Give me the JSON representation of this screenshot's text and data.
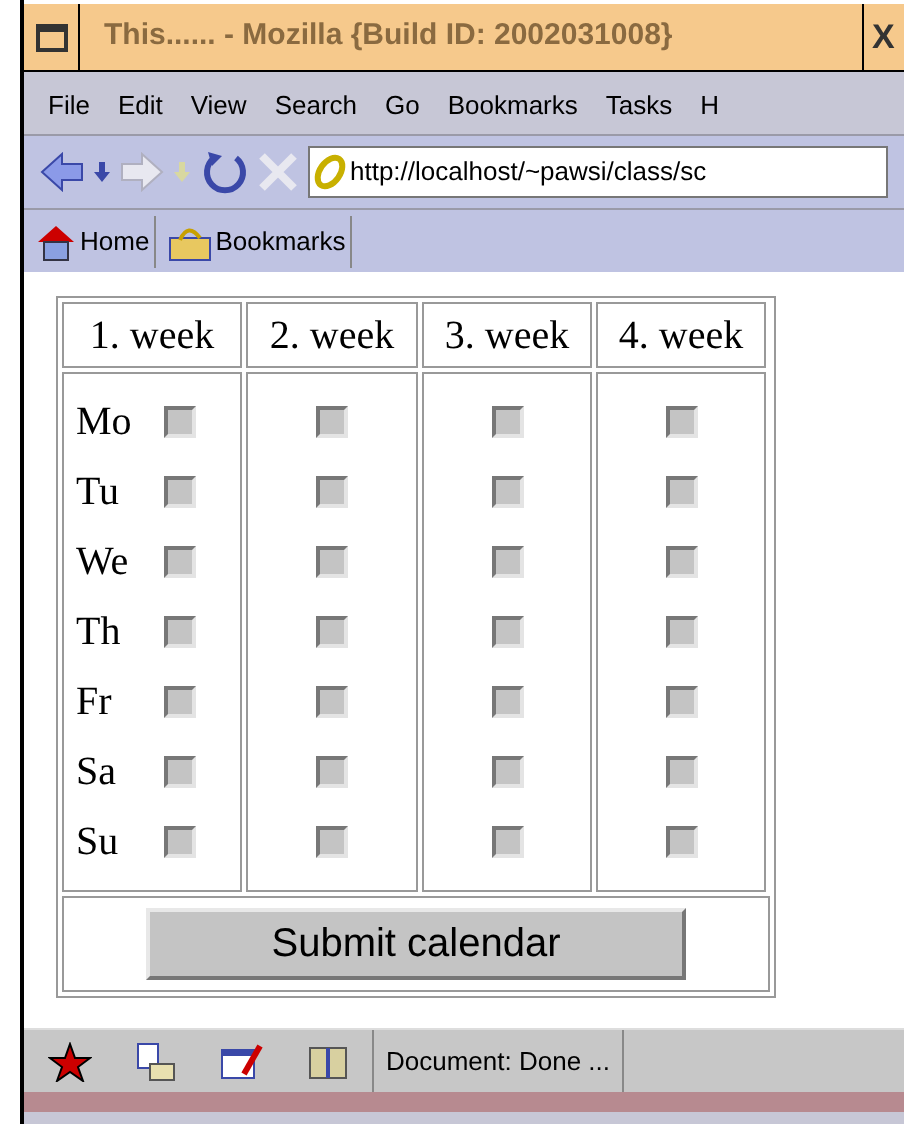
{
  "window": {
    "title": "This...... - Mozilla {Build ID: 2002031008}",
    "close": "X"
  },
  "menu": [
    "File",
    "Edit",
    "View",
    "Search",
    "Go",
    "Bookmarks",
    "Tasks",
    "H"
  ],
  "address": {
    "value": "http://localhost/~pawsi/class/sc"
  },
  "personal_toolbar": [
    "Home",
    "Bookmarks"
  ],
  "weeks": [
    "1. week",
    "2. week",
    "3. week",
    "4. week"
  ],
  "days": [
    {
      "label": "Mo",
      "checked": [
        false,
        false,
        false,
        false
      ]
    },
    {
      "label": "Tu",
      "checked": [
        false,
        false,
        false,
        false
      ]
    },
    {
      "label": "We",
      "checked": [
        false,
        false,
        false,
        false
      ]
    },
    {
      "label": "Th",
      "checked": [
        false,
        false,
        false,
        false
      ]
    },
    {
      "label": "Fr",
      "checked": [
        false,
        false,
        false,
        false
      ]
    },
    {
      "label": "Sa",
      "checked": [
        false,
        false,
        false,
        false
      ]
    },
    {
      "label": "Su",
      "checked": [
        false,
        false,
        false,
        false
      ]
    }
  ],
  "submit": "Submit calendar",
  "status_bar": {
    "text": "Document: Done ..."
  }
}
